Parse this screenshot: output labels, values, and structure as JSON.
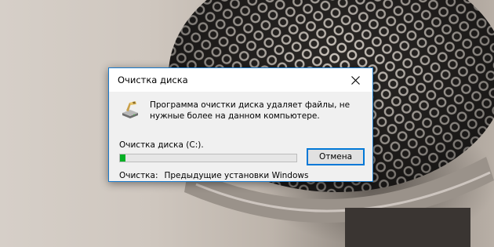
{
  "dialog": {
    "title": "Очистка диска",
    "message": "Программа очистки диска удаляет файлы, не нужные более на данном компьютере.",
    "drive_label": "Очистка диска  (C:).",
    "progress": 0.03,
    "cancel_label": "Отмена",
    "status_label": "Очистка:",
    "status_value": "Предыдущие установки Windows"
  },
  "icons": {
    "close": "close-icon",
    "disk_cleanup": "disk-cleanup-icon"
  },
  "colors": {
    "accent_border": "#1979ca",
    "progress_fill": "#06b025",
    "button_focus": "#0078d7"
  }
}
